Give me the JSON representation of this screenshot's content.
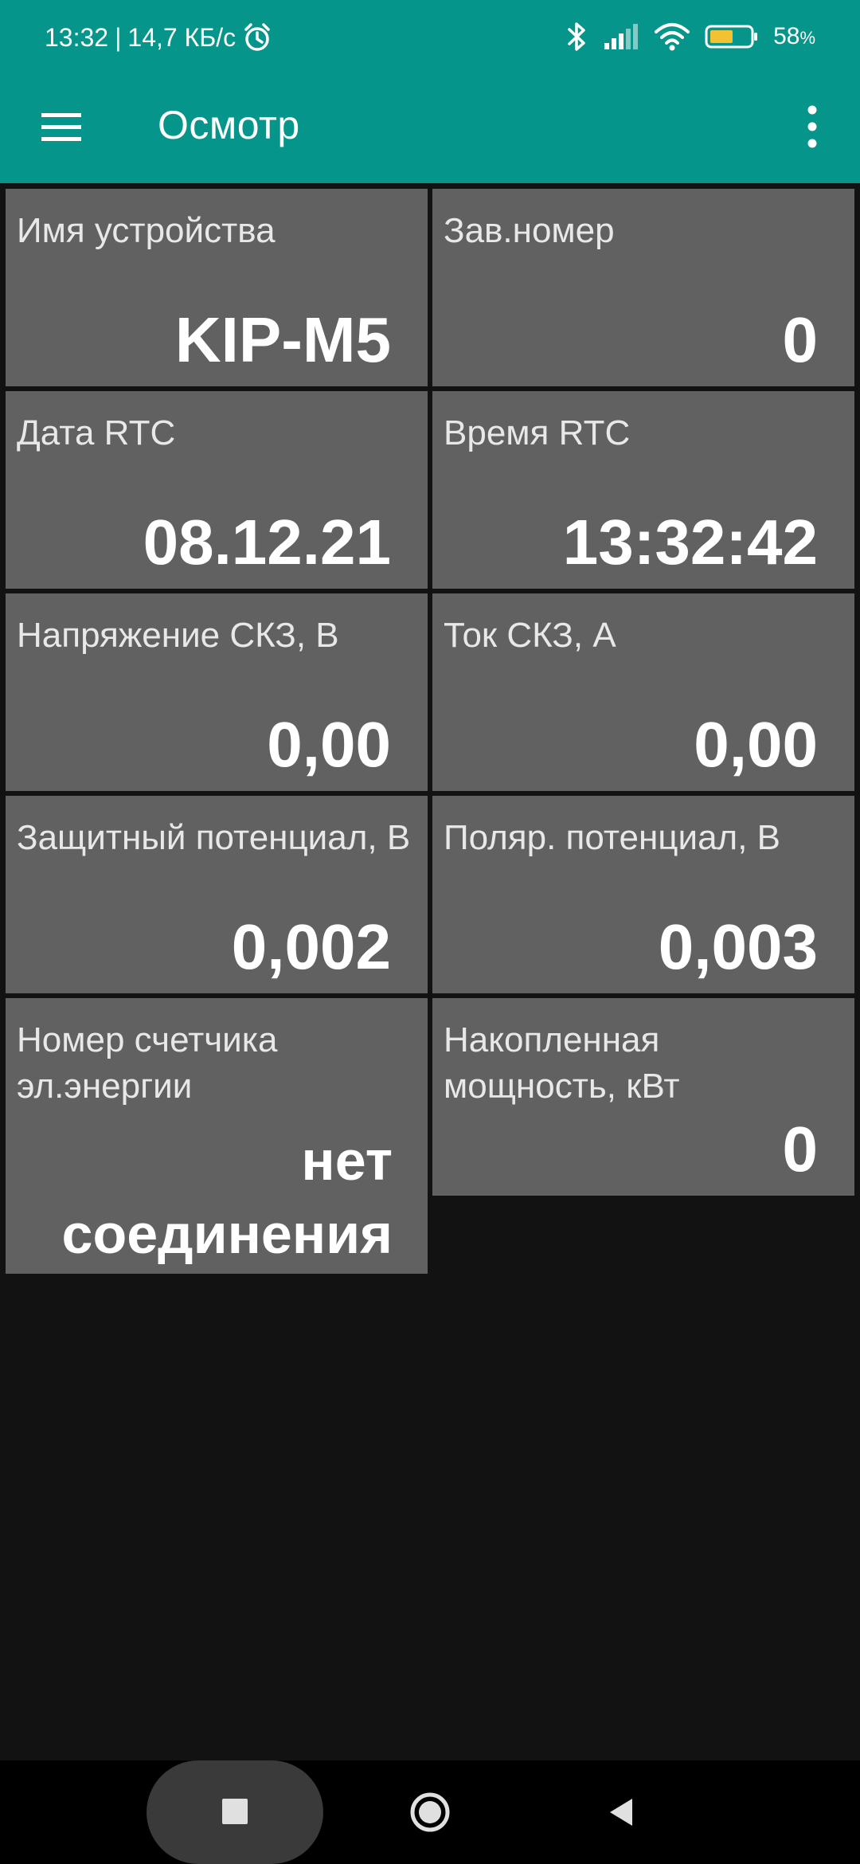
{
  "status_bar": {
    "time": "13:32",
    "separator": "|",
    "network_speed": "14,7 КБ/с",
    "battery_percent": "58",
    "battery_symbol": "%",
    "battery_level": 0.58,
    "icons": [
      "alarm-icon",
      "bluetooth-icon",
      "signal-icon",
      "wifi-icon",
      "battery-icon"
    ]
  },
  "app_bar": {
    "title": "Осмотр",
    "menu_icon": "hamburger-menu-icon",
    "more_icon": "more-vertical-icon",
    "color": "#06958a"
  },
  "tiles": [
    {
      "label": "Имя устройства",
      "value": "KIP-M5"
    },
    {
      "label": "Зав.номер",
      "value": "0"
    },
    {
      "label": "Дата RTC",
      "value": "08.12.21"
    },
    {
      "label": "Время RTC",
      "value": "13:32:42"
    },
    {
      "label": "Напряжение СКЗ, В",
      "value": "0,00"
    },
    {
      "label": "Ток СКЗ, А",
      "value": "0,00"
    },
    {
      "label": "Защитный потенциал, В",
      "value": "0,002"
    },
    {
      "label": "Поляр. потенциал, В",
      "value": "0,003"
    },
    {
      "label": "Номер счетчика эл.энергии",
      "value": "нет соединения"
    },
    {
      "label": "Накопленная мощность, кВт",
      "value": "0"
    }
  ],
  "nav_bar": {
    "icons": [
      "recents-square-icon",
      "home-circle-icon",
      "back-triangle-icon"
    ]
  }
}
